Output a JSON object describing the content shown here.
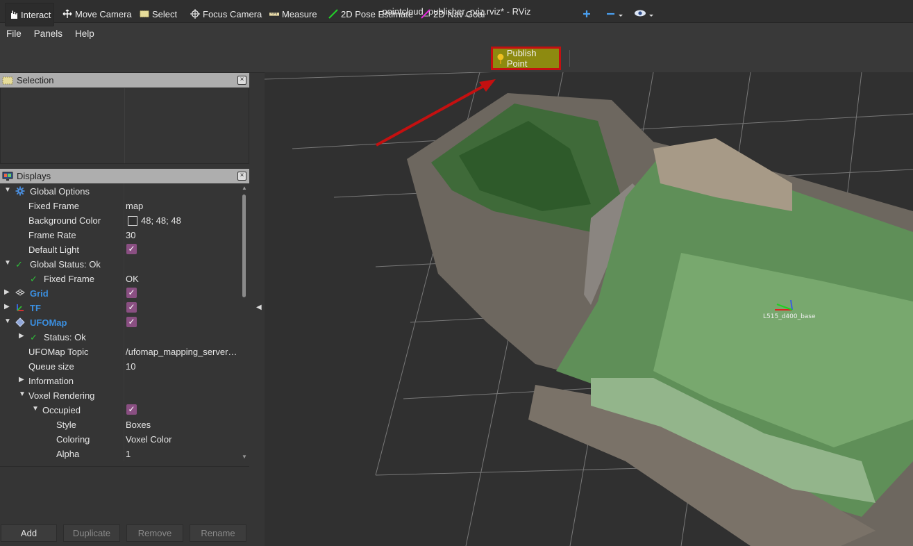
{
  "window": {
    "title": "pointcloud_publisher_rviz.rviz* - RViz"
  },
  "menu": {
    "file": "File",
    "panels": "Panels",
    "help": "Help"
  },
  "toolbar": {
    "interact": "Interact",
    "move_camera": "Move Camera",
    "select": "Select",
    "focus_camera": "Focus Camera",
    "measure": "Measure",
    "pose_estimate": "2D Pose Estimate",
    "nav_goal": "2D Nav Goal",
    "publish_point": "Publish Point",
    "add_tool_icon": "plus-icon",
    "remove_tool_icon": "minus-icon",
    "view_icon": "eye-icon"
  },
  "selection_panel": {
    "title": "Selection"
  },
  "displays_panel": {
    "title": "Displays",
    "rows": {
      "global_options": "Global Options",
      "fixed_frame": {
        "label": "Fixed Frame",
        "value": "map"
      },
      "background_color": {
        "label": "Background Color",
        "value": "48; 48; 48"
      },
      "frame_rate": {
        "label": "Frame Rate",
        "value": "30"
      },
      "default_light": {
        "label": "Default Light",
        "checked": true
      },
      "global_status": "Global Status: Ok",
      "status_fixed_frame": {
        "label": "Fixed Frame",
        "value": "OK"
      },
      "grid": {
        "label": "Grid",
        "checked": true
      },
      "tf": {
        "label": "TF",
        "checked": true
      },
      "ufomap": {
        "label": "UFOMap",
        "checked": true
      },
      "status_ok": "Status: Ok",
      "ufomap_topic": {
        "label": "UFOMap Topic",
        "value": "/ufomap_mapping_server…"
      },
      "queue_size": {
        "label": "Queue size",
        "value": "10"
      },
      "information": "Information",
      "voxel_rendering": "Voxel Rendering",
      "occupied": {
        "label": "Occupied",
        "checked": true
      },
      "style": {
        "label": "Style",
        "value": "Boxes"
      },
      "coloring": {
        "label": "Coloring",
        "value": "Voxel Color"
      },
      "alpha": {
        "label": "Alpha",
        "value": "1"
      }
    }
  },
  "buttons": {
    "add": "Add",
    "duplicate": "Duplicate",
    "remove": "Remove",
    "rename": "Rename"
  },
  "viewport": {
    "frame_label": "L515_d400_base"
  },
  "colors": {
    "highlight_border": "#c41010",
    "publish_bg": "#8d8a10",
    "checkbox": "#8a4f82",
    "link_blue": "#3b8fe0"
  }
}
